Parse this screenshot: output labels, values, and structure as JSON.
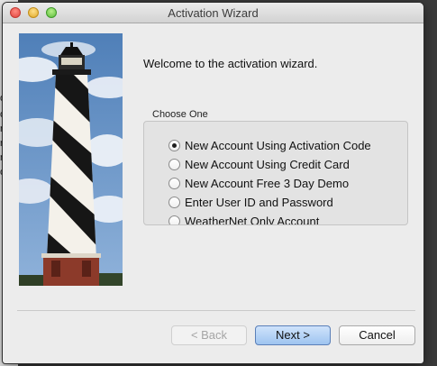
{
  "background_fragments": [
    "on",
    "or",
    "ne",
    "ne",
    "ne",
    "or"
  ],
  "window": {
    "title": "Activation Wizard"
  },
  "sidebar_image": {
    "description": "lighthouse-photo"
  },
  "welcome_text": "Welcome to the activation wizard.",
  "choose_group": {
    "title": "Choose One",
    "options": [
      {
        "label": "New Account Using Activation Code",
        "selected": true
      },
      {
        "label": "New Account Using Credit Card",
        "selected": false
      },
      {
        "label": "New Account Free 3 Day Demo",
        "selected": false
      },
      {
        "label": "Enter User ID and Password",
        "selected": false
      },
      {
        "label": "WeatherNet Only Account",
        "selected": false
      }
    ]
  },
  "buttons": {
    "back": "< Back",
    "next": "Next >",
    "cancel": "Cancel"
  },
  "colors": {
    "next_button": "#9ec4f0",
    "lighthouse_black": "#161616",
    "sky": "#6f98c9"
  }
}
